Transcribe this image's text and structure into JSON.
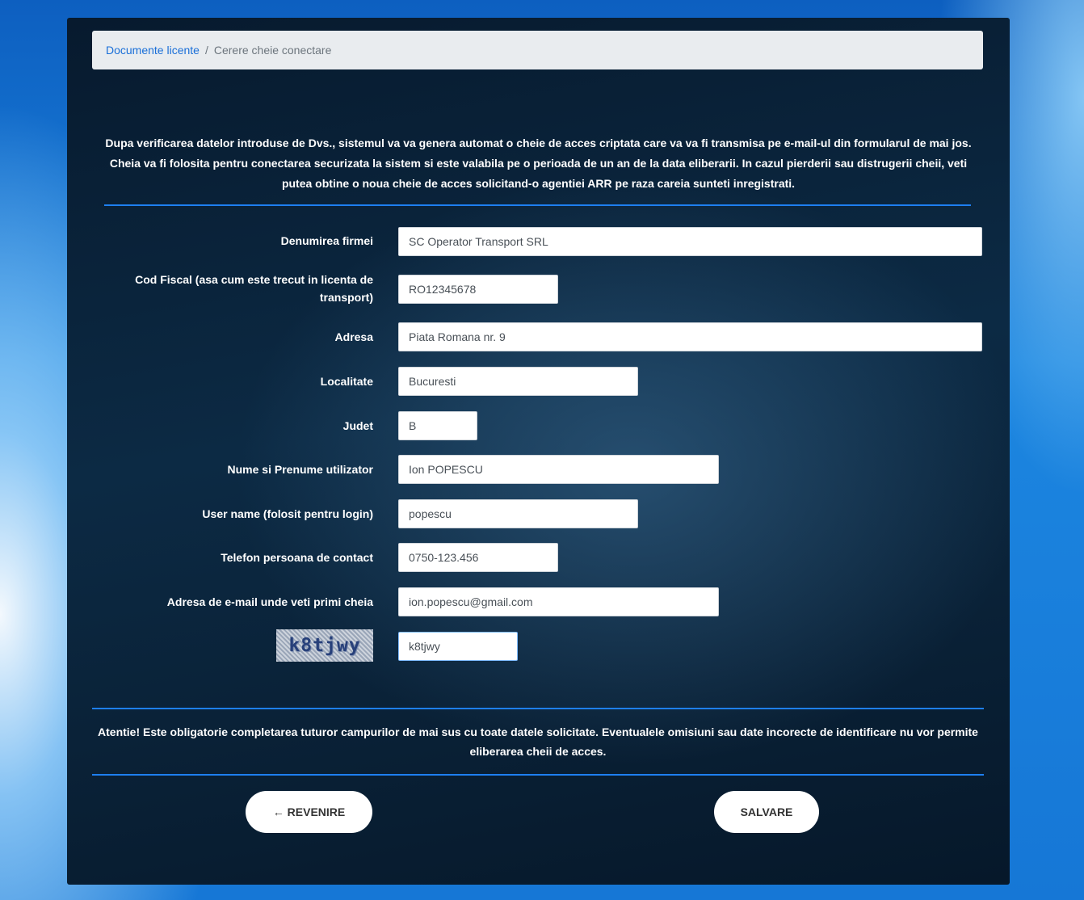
{
  "breadcrumb": {
    "link": "Documente licente",
    "separator": "/",
    "current": "Cerere cheie conectare"
  },
  "intro": "Dupa verificarea datelor introduse de Dvs., sistemul va va genera automat o cheie de acces criptata care va va fi transmisa pe e-mail-ul din formularul de mai jos. Cheia va fi folosita pentru conectarea securizata la sistem si este valabila pe o perioada de un an de la data eliberarii. In cazul pierderii sau distrugerii cheii, veti putea obtine o noua cheie de acces solicitand-o agentiei ARR pe raza careia sunteti inregistrati.",
  "form": {
    "denumire": {
      "label": "Denumirea firmei",
      "value": "SC Operator Transport SRL"
    },
    "cod_fiscal": {
      "label": "Cod Fiscal (asa cum este trecut in licenta de transport)",
      "value": "RO12345678"
    },
    "adresa": {
      "label": "Adresa",
      "value": "Piata Romana nr. 9"
    },
    "localitate": {
      "label": "Localitate",
      "value": "Bucuresti"
    },
    "judet": {
      "label": "Judet",
      "value": "B"
    },
    "nume": {
      "label": "Nume si Prenume utilizator",
      "value": "Ion POPESCU"
    },
    "username": {
      "label": "User name (folosit pentru login)",
      "value": "popescu"
    },
    "telefon": {
      "label": "Telefon persoana de contact",
      "value": "0750-123.456"
    },
    "email": {
      "label": "Adresa de e-mail unde veti primi cheia",
      "value": "ion.popescu@gmail.com"
    },
    "captcha": {
      "image_text": "k8tjwy",
      "value": "k8tjwy"
    }
  },
  "warning": "Atentie! Este obligatorie completarea tuturor campurilor de mai sus cu toate datele solicitate. Eventualele omisiuni sau date incorecte de identificare nu vor permite eliberarea cheii de acces.",
  "buttons": {
    "back": "← REVENIRE",
    "save": "SALVARE"
  }
}
